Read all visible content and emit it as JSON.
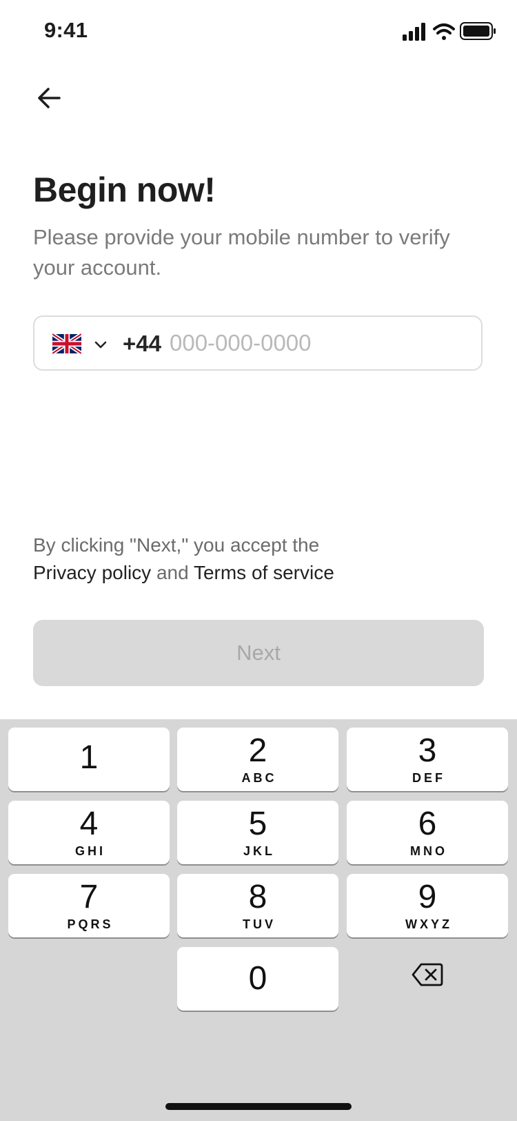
{
  "status_bar": {
    "time": "9:41"
  },
  "header": {
    "back_icon": "arrow-left-icon"
  },
  "main": {
    "title": "Begin now!",
    "subtitle": "Please provide your mobile number to verify your account.",
    "phone": {
      "country_flag": "uk-flag-icon",
      "dial_code": "+44",
      "value": "",
      "placeholder": "000-000-0000"
    },
    "legal": {
      "prefix": "By clicking \"Next,\" you accept the",
      "privacy_link": "Privacy policy",
      "conjunction": "and",
      "terms_link": "Terms of service"
    },
    "next_label": "Next"
  },
  "keyboard": {
    "keys": [
      {
        "num": "1",
        "letters": ""
      },
      {
        "num": "2",
        "letters": "ABC"
      },
      {
        "num": "3",
        "letters": "DEF"
      },
      {
        "num": "4",
        "letters": "GHI"
      },
      {
        "num": "5",
        "letters": "JKL"
      },
      {
        "num": "6",
        "letters": "MNO"
      },
      {
        "num": "7",
        "letters": "PQRS"
      },
      {
        "num": "8",
        "letters": "TUV"
      },
      {
        "num": "9",
        "letters": "WXYZ"
      },
      {
        "num": "0",
        "letters": ""
      }
    ],
    "delete_icon": "backspace-icon"
  },
  "colors": {
    "button_disabled_bg": "#d9d9d9",
    "keyboard_bg": "#d6d6d6"
  }
}
